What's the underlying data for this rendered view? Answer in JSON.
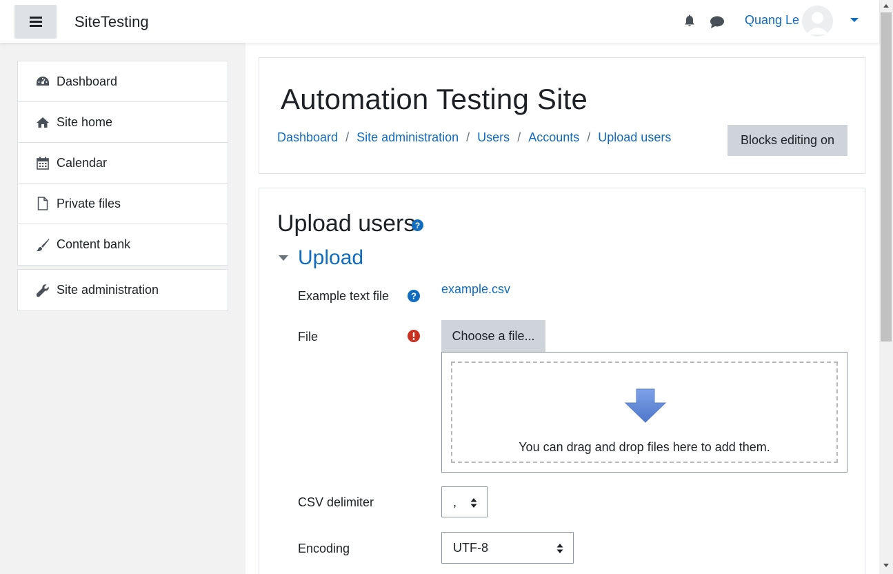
{
  "navbar": {
    "menu_icon": "hamburger-icon",
    "site_name": "SiteTesting",
    "notifications_icon": "bell-icon",
    "messages_icon": "chat-icon",
    "user_name": "Quang Le",
    "user_menu_icon": "caret-down-icon"
  },
  "drawer": {
    "items": [
      {
        "label": "Dashboard",
        "icon": "dashboard-icon"
      },
      {
        "label": "Site home",
        "icon": "home-icon"
      },
      {
        "label": "Calendar",
        "icon": "calendar-icon"
      },
      {
        "label": "Private files",
        "icon": "file-icon"
      },
      {
        "label": "Content bank",
        "icon": "paintbrush-icon"
      }
    ],
    "admin_item": {
      "label": "Site administration",
      "icon": "wrench-icon"
    }
  },
  "header": {
    "site_title": "Automation Testing Site",
    "breadcrumb": [
      "Dashboard",
      "Site administration",
      "Users",
      "Accounts",
      "Upload users"
    ],
    "blocks_editing_label": "Blocks editing on"
  },
  "content": {
    "page_heading": "Upload users",
    "section_title": "Upload",
    "example_label": "Example text file",
    "example_link": "example.csv",
    "file_label": "File",
    "choose_file_label": "Choose a file...",
    "drop_text": "You can drag and drop files here to add them.",
    "csv_delimiter_label": "CSV delimiter",
    "csv_delimiter_value": ",",
    "encoding_label": "Encoding",
    "encoding_value": "UTF-8"
  },
  "colors": {
    "link": "#0f6cbf",
    "help": "#0f6cbf",
    "required": "#ca3120",
    "button_secondary": "#ced4da"
  }
}
